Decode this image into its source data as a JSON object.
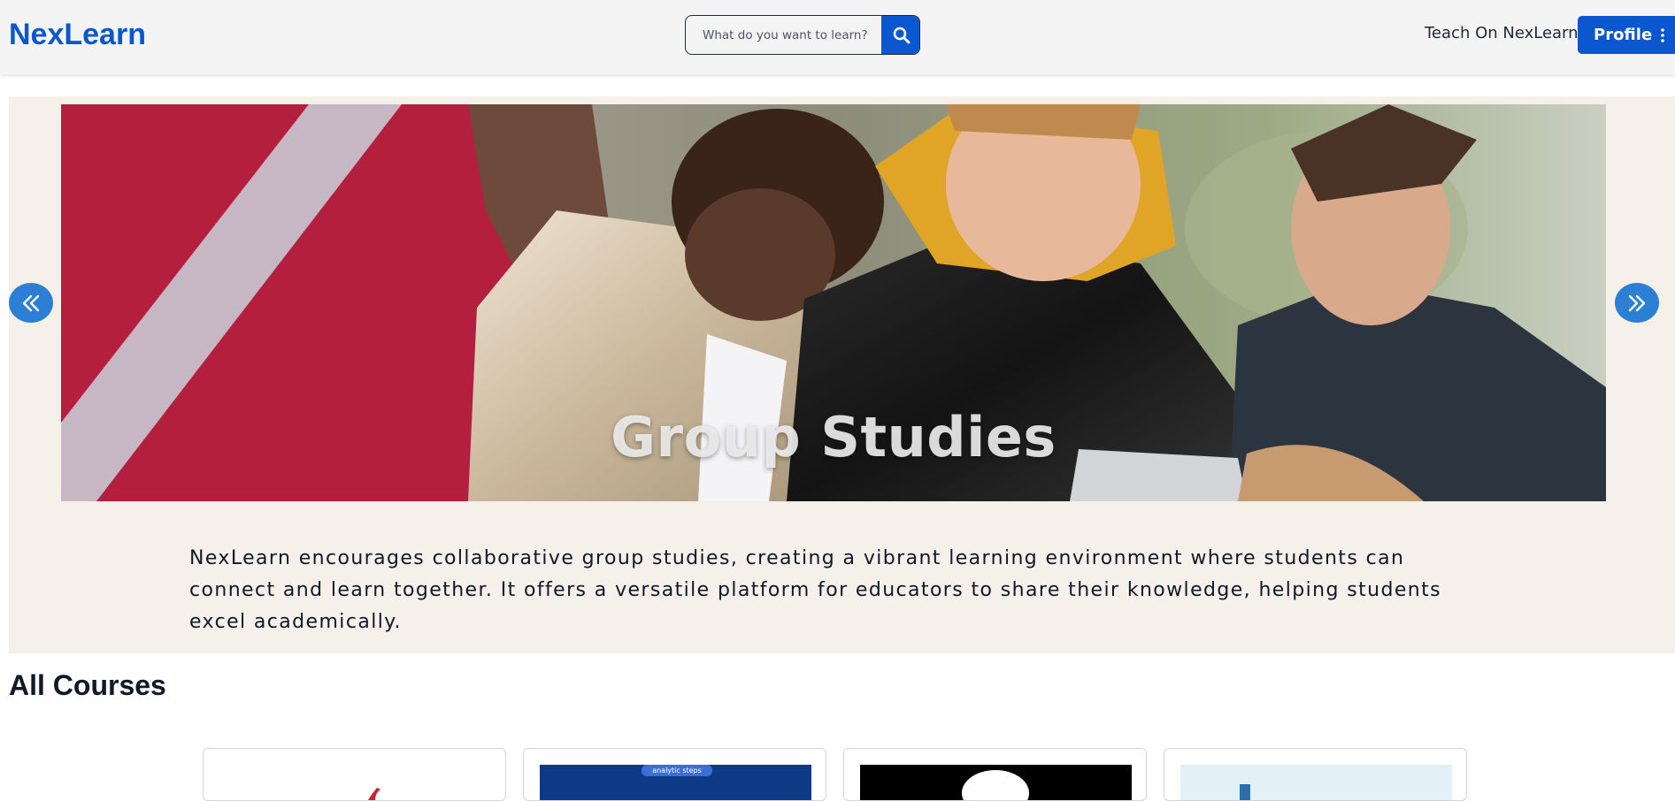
{
  "navbar": {
    "logo": "NexLearn",
    "search": {
      "placeholder": "What do you want to learn?"
    },
    "search_icon": "search-icon",
    "teach_link": "Teach On NexLearn",
    "profile_button": "Profile",
    "profile_icon": "kebab-menu-icon",
    "brand_color": "#0b57d0"
  },
  "hero": {
    "title": "Group Studies",
    "description": "NexLearn encourages collaborative group studies, creating a vibrant learning environment where students can connect and learn together. It offers a versatile platform for educators to share their knowledge, helping students excel academically.",
    "prev_icon": "double-chevron-left-icon",
    "next_icon": "double-chevron-right-icon",
    "background_color": "#f5f0e9"
  },
  "courses": {
    "heading": "All Courses",
    "cards": [
      {
        "thumbnail": "red-logo-thumbnail"
      },
      {
        "thumbnail": "analytic-steps-thumbnail",
        "banner_text": "analytic steps"
      },
      {
        "thumbnail": "black-circle-thumbnail"
      },
      {
        "thumbnail": "light-blue-thumbnail"
      }
    ]
  }
}
